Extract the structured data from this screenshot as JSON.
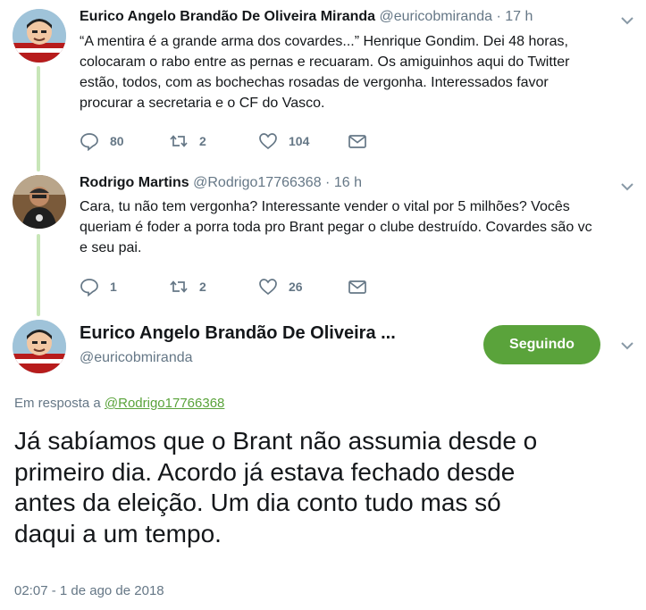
{
  "tweet1": {
    "name": "Eurico Angelo Brandão De Oliveira Miranda",
    "handle": "@euricobmiranda",
    "dot": "·",
    "time": "17 h",
    "lines": [
      "“A mentira é a grande arma dos covardes...” Henrique Gondim. Dei 48 horas,",
      "colocaram o rabo entre as pernas e recuaram. Os amiguinhos aqui do Twitter",
      "estão, todos, com as bochechas rosadas de vergonha. Interessados favor",
      "procurar a secretaria e o CF do Vasco."
    ],
    "replies": "80",
    "retweets": "2",
    "likes": "104"
  },
  "tweet2": {
    "name": "Rodrigo Martins",
    "handle": "@Rodrigo17766368",
    "dot": "·",
    "time": "16 h",
    "lines": [
      "Cara, tu não tem vergonha? Interessante vender o vital por 5 milhões? Vocês",
      "queriam é foder a porra toda pro Brant pegar o clube destruído. Covardes são vc",
      "e seu pai."
    ],
    "replies": "1",
    "retweets": "2",
    "likes": "26"
  },
  "main": {
    "name": "Eurico Angelo Brandão De Oliveira ...",
    "handle": "@euricobmiranda",
    "follow_label": "Seguindo",
    "reply_prefix": "Em resposta a",
    "reply_handle": "@Rodrigo17766368",
    "lines": [
      "Já sabíamos que o Brant não assumia desde o",
      "primeiro dia. Acordo já estava fechado desde",
      "antes da eleição. Um dia conto tudo mas só",
      "daqui a um tempo."
    ],
    "timestamp": "02:07 - 1 de ago de 2018"
  },
  "icons": {
    "reply": "reply-icon",
    "retweet": "retweet-icon",
    "like": "heart-icon",
    "dm": "envelope-icon",
    "caret": "chevron-down-icon"
  },
  "colors": {
    "accent": "#5aa33b",
    "muted": "#657786",
    "thread": "#c8e6b8"
  }
}
